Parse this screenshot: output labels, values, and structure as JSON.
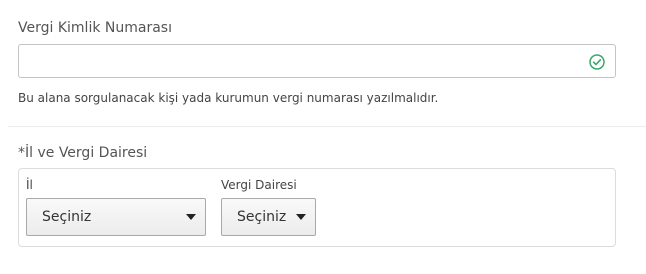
{
  "tax_number": {
    "label": "Vergi Kimlik Numarası",
    "value": "",
    "placeholder": "",
    "status_icon": "check-circle-icon",
    "status_color": "#3aa76d",
    "help_text": "Bu alana sorgulanacak kişi yada kurumun vergi numarası yazılmalıdır."
  },
  "province_office": {
    "required_mark": "*",
    "label": "İl ve Vergi Dairesi",
    "province": {
      "label": "İl",
      "selected": "Seçiniz"
    },
    "tax_office": {
      "label": "Vergi Dairesi",
      "selected": "Seçiniz"
    }
  }
}
